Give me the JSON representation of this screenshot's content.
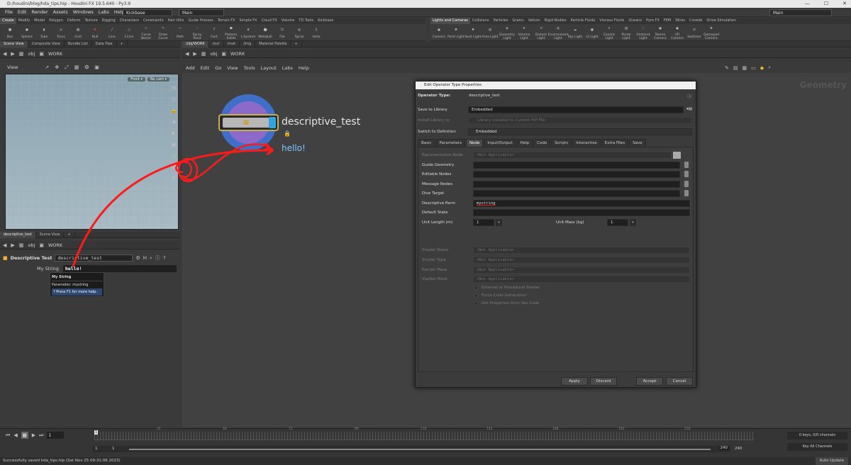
{
  "window": {
    "title": "D:/houdini/blog/hda_tips.hip - Houdini FX 19.5.640 - Py3.9"
  },
  "menu": {
    "items": [
      "File",
      "Edit",
      "Render",
      "Assets",
      "Windows",
      "Labs",
      "Help"
    ],
    "desktop": "Kickbase",
    "main": "Main",
    "right_main": "Main"
  },
  "shelf_left": {
    "tabs": [
      "Create",
      "Modify",
      "Model",
      "Polygon",
      "Deform",
      "Texture",
      "Rigging",
      "Characters",
      "Constraints",
      "Hair Utils",
      "Guide Process",
      "Terrain FX",
      "Simple FX",
      "Cloud FX",
      "Volume",
      "TD Tools",
      "Kickbase"
    ],
    "tools": [
      "Box",
      "Sphere",
      "Tube",
      "Torus",
      "Grid",
      "Null",
      "Line",
      "Circle",
      "Curve Bezier",
      "Draw Curve",
      "Path",
      "Spray Paint",
      "Font",
      "Platonic Solids",
      "L-System",
      "Metaball",
      "File",
      "Spiral",
      "Helix"
    ]
  },
  "shelf_right": {
    "tabs": [
      "Lights and Cameras",
      "Collisions",
      "Particles",
      "Grains",
      "Vellum",
      "Rigid Bodies",
      "Particle Fluids",
      "Viscous Fluids",
      "Oceans",
      "Pyro FX",
      "FEM",
      "Wires",
      "Crowds",
      "Drive Simulation"
    ],
    "tools": [
      "Camera",
      "Point Light",
      "Spot Light",
      "Area Light",
      "Geometry Light",
      "Volume Light",
      "Distant Light",
      "Environment Light",
      "Sky Light",
      "GI Light",
      "Caustic Light",
      "Portal Light",
      "Ambient Light",
      "Stereo Camera",
      "VR Camera",
      "Switcher",
      "Gamepad Camera"
    ]
  },
  "left_top": {
    "tabs": [
      "Scene View",
      "Composite View",
      "Bundle List",
      "Data Tree"
    ],
    "path": [
      "obj",
      "WORK"
    ],
    "view_label": "View",
    "front_btn": "Front",
    "cam_btn": "No cam"
  },
  "left_bottom": {
    "tabs": [
      "descriptive_test",
      "Scene View"
    ],
    "path": [
      "obj",
      "WORK"
    ],
    "node_type": "Descriptive Test",
    "node_name": "descriptive_test",
    "parm_label": "My String",
    "parm_value": "hello!",
    "tooltip": {
      "title": "My String",
      "parameter": "Parameter: mystring",
      "help": "Press F1 for more help."
    }
  },
  "net": {
    "tabs": [
      "/obj/WORK",
      "/out",
      "/mat",
      "/img",
      "Material Palette"
    ],
    "path": [
      "obj",
      "WORK"
    ],
    "menu": [
      "Add",
      "Edit",
      "Go",
      "View",
      "Tools",
      "Layout",
      "Labs",
      "Help"
    ],
    "node_name": "descriptive_test",
    "node_comment": "hello!",
    "context_label": "Geometry"
  },
  "dialog": {
    "title": "Edit Operator Type Properties",
    "operator_type_label": "Operator Type:",
    "operator_type": "descriptive_test",
    "save_to_library_label": "Save to Library",
    "save_to_library": "Embedded",
    "install_library_label": "Install Library to",
    "install_library": "Library installed to Current HIP File",
    "switch_definition_label": "Switch to Definition",
    "switch_definition": "Embedded",
    "tabs": [
      "Basic",
      "Parameters",
      "Node",
      "Input/Output",
      "Help",
      "Code",
      "Scripts",
      "Interactive",
      "Extra Files",
      "Save"
    ],
    "fields": {
      "rep_node": {
        "label": "Representative Node",
        "value": "<Not Applicable>"
      },
      "guide": {
        "label": "Guide Geometry",
        "value": ""
      },
      "editable": {
        "label": "Editable Nodes",
        "value": ""
      },
      "message": {
        "label": "Message Nodes",
        "value": ""
      },
      "dive": {
        "label": "Dive Target",
        "value": ""
      },
      "descriptive": {
        "label": "Descriptive Parm",
        "value": "mystring"
      },
      "default_state": {
        "label": "Default State",
        "value": ""
      },
      "unit_length": {
        "label": "Unit Length (m)",
        "value": "1"
      },
      "unit_mass": {
        "label": "Unit Mass (kg)",
        "value": "1"
      },
      "shader_name": {
        "label": "Shader Name",
        "value": "<Not Applicable>"
      },
      "shader_type": {
        "label": "Shader Type",
        "value": "<Not Applicable>"
      },
      "render_mask": {
        "label": "Render Mask",
        "value": "<Not Applicable>"
      },
      "vopnet_mask": {
        "label": "VopNet Mask",
        "value": "<Not Applicable>"
      }
    },
    "checks": [
      "External or Procedural Shader",
      "Force Code Generation",
      "Get Properties from Vex Code"
    ],
    "buttons": {
      "apply": "Apply",
      "discard": "Discard",
      "accept": "Accept",
      "cancel": "Cancel"
    }
  },
  "timeline": {
    "frame": "1",
    "ticks": [
      "24",
      "48",
      "72",
      "96",
      "120",
      "144",
      "168",
      "192",
      "216"
    ],
    "start": "1",
    "start2": "1",
    "end": "240",
    "end2": "240",
    "keys": "0 keys, 0/0 channels",
    "channels": "Key All Channels",
    "auto_update": "Auto Update"
  },
  "status": "Successfully saved hda_tips.hip (Sat Nov 25 09:31:06 2023)"
}
